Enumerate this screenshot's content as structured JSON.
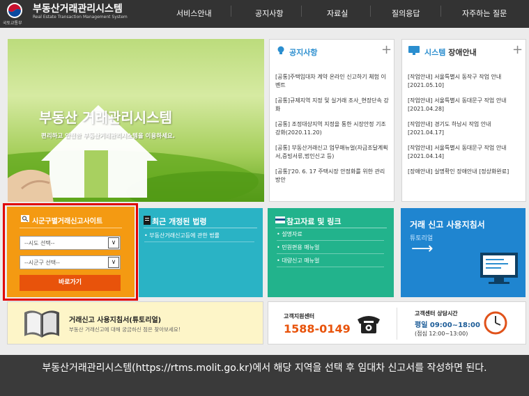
{
  "header": {
    "ministry": "국토교통부",
    "title": "부동산거래관리시스템",
    "subtitle": "Real Estate Transaction Management System",
    "nav": [
      "서비스안내",
      "공지사항",
      "자료실",
      "질의응답",
      "자주하는 질문"
    ]
  },
  "hero": {
    "title": "부동산 거래관리시스템",
    "subtitle": "편리하고 안전한 부동산거래관리시스템을 이용하세요."
  },
  "notice": {
    "title": "공지사항",
    "items": [
      "[공통]주택임대차 계약 온라인 신고하기 체험 이벤트",
      "[공통]규제지역 지정 및 실거래 조사_현장단속 강화",
      "[공통] 조정대상지역 지정을 통한 시장안정 기조 강화(2020.11.20)",
      "[공통] 부동산거래신고 업무매뉴얼(자금조달계획서,증빙서류,법인신고 등)",
      "[공통]'20. 6. 17 주택시장 안정화를 위한 관리방안"
    ]
  },
  "system": {
    "title_a": "시스템",
    "title_b": "장애안내",
    "items": [
      {
        "text": "[작업안내] 서울특별시 동작구 작업 안내",
        "date": "[2021.05.10]"
      },
      {
        "text": "[작업안내] 서울특별시 동대문구 작업 안내",
        "date": "[2021.04.28]"
      },
      {
        "text": "[작업안내] 경기도 하남시 작업 안내",
        "date": "[2021.04.17]"
      },
      {
        "text": "[작업안내] 서울특별시 동대문구 작업 안내",
        "date": "[2021.04.14]"
      },
      {
        "text": "[장애안내] 실명확인 장애안내 [정상화완료]",
        "date": ""
      }
    ]
  },
  "search": {
    "title": "시군구별거래신고사이트",
    "sido": "--시도 선택--",
    "sigungu": "--시군구 선택--",
    "button": "바로가기"
  },
  "laws": {
    "title": "최근 개정된 법령",
    "items": [
      "부동산거래신고등에 관한 법률"
    ]
  },
  "refs": {
    "title": "참고자료 및 링크",
    "items": [
      "설명자료",
      "민원편용 매뉴얼",
      "대량신고 매뉴얼"
    ]
  },
  "guide": {
    "title": "거래 신고 사용지침서",
    "sub": "튜토리얼",
    "arrow": "⟶"
  },
  "banner_guide": {
    "title": "거래신고 사용지침서(튜토리얼)",
    "desc": "부동산 거래신고에 대해 궁금하신 점은 찾아보세요!"
  },
  "support": {
    "label": "고객지원센터",
    "phone": "1588-0149"
  },
  "hours": {
    "label": "고객센터 상담시간",
    "weekday": "평일 09:00~18:00",
    "lunch": "(점심 12:00~13:00)"
  },
  "caption": "부동산거래관리시스템(https://rtms.molit.go.kr)에서 해당 지역을 선택 후 임대차 신고서를 작성하면 된다.",
  "colors": {
    "header": "#333333",
    "orange": "#f49a12",
    "orange_button": "#e8530b",
    "highlight": "#e00000",
    "tile_cyan": "#2ab3c5",
    "tile_green": "#22b38c",
    "tile_blue": "#1f85d0",
    "link_blue": "#2b8ecf"
  }
}
